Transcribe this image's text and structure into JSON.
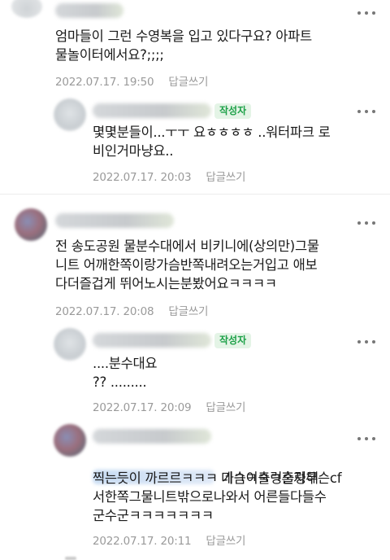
{
  "comments": [
    {
      "text": "엄마들이 그런 수영복을 입고 있다구요? 아파트\n물놀이터에서요?;;;;",
      "date": "2022.07.17. 19:50",
      "reply_label": "답글쓰기"
    },
    {
      "badge": "작성자",
      "text": "몇몇분들이...ㅜㅜ 요ㅎㅎㅎㅎ ..워터파크 로\n비인거마냥요..",
      "date": "2022.07.17. 20:03",
      "reply_label": "답글쓰기"
    },
    {
      "text": "전 송도공원 물분수대에서 비키니에(상의만)그물\n니트 어깨한쪽이랑가슴반쪽내려오는거입고 애보\n다더즐겁게 뛰어노시는분봤어요ㅋㅋㅋㅋ",
      "date": "2022.07.17. 20:08",
      "reply_label": "답글쓰기"
    },
    {
      "badge": "작성자",
      "text": "....분수대요\n?? .........",
      "date": "2022.07.17. 20:09",
      "reply_label": "답글쓰기"
    },
    {
      "text_first": "네ㅋㅋㅋㅋ혼자무슨cf",
      "text": "찍는듯이 까르르ㅋㅋㅋ 가슴이출렁출렁해\n서한쪽그물니트밖으로나와서 어른들다들수\n군수군ㅋㅋㅋㅋㅋㅋㅋ",
      "date": "2022.07.17. 20:11",
      "reply_label": "답글쓰기"
    }
  ],
  "colors": {
    "badge_text": "#1ea149",
    "badge_bg": "#e4f4e6",
    "meta": "#9a9a9a"
  },
  "icons": {
    "more": "more-vertical-dots-icon"
  }
}
